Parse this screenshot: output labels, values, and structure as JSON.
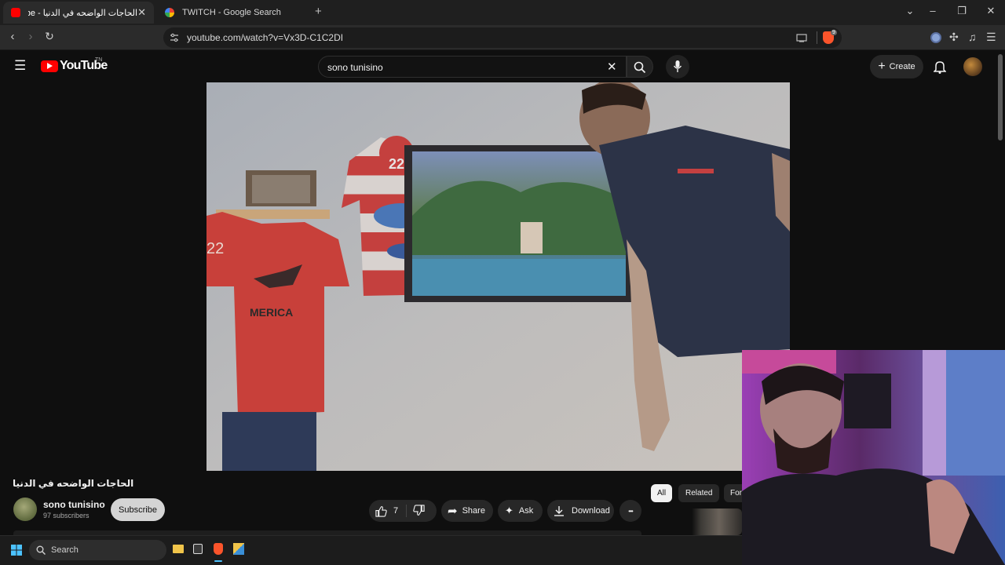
{
  "browser": {
    "tabs": [
      {
        "title": "الحاجات الواضحه في الدنيا - YouTube",
        "active": true,
        "favicon": "youtube-favicon"
      },
      {
        "title": "TWITCH - Google Search",
        "active": false,
        "favicon": "google-favicon"
      }
    ],
    "new_tab_symbol": "+",
    "url": "youtube.com/watch?v=Vx3D-C1C2DI",
    "extension_badge": "9"
  },
  "youtube": {
    "logo_text": "YouTube",
    "logo_region": "TN",
    "search_query": "sono tunisino",
    "create_label": "Create",
    "video": {
      "title": "الحاجات الواضحه في الدنيا",
      "channel": "sono tunisino",
      "subscribers": "97 subscribers",
      "subscribe_label": "Subscribe",
      "likes": "7",
      "share_label": "Share",
      "ask_label": "Ask",
      "download_label": "Download",
      "more_symbol": "•••"
    },
    "chips": [
      "All",
      "Related",
      "For"
    ]
  },
  "video_scene": {
    "shirt_left_number": "22",
    "shirt_left_text": "MERICA",
    "shirt_right_number": "22"
  },
  "taskbar": {
    "search_placeholder": "Search"
  },
  "colors": {
    "youtube_red": "#ff0000",
    "dark_bg": "#0f0f0f",
    "chip_active_bg": "#f1f1f1",
    "subscribe_bg": "#d4d4d4"
  }
}
